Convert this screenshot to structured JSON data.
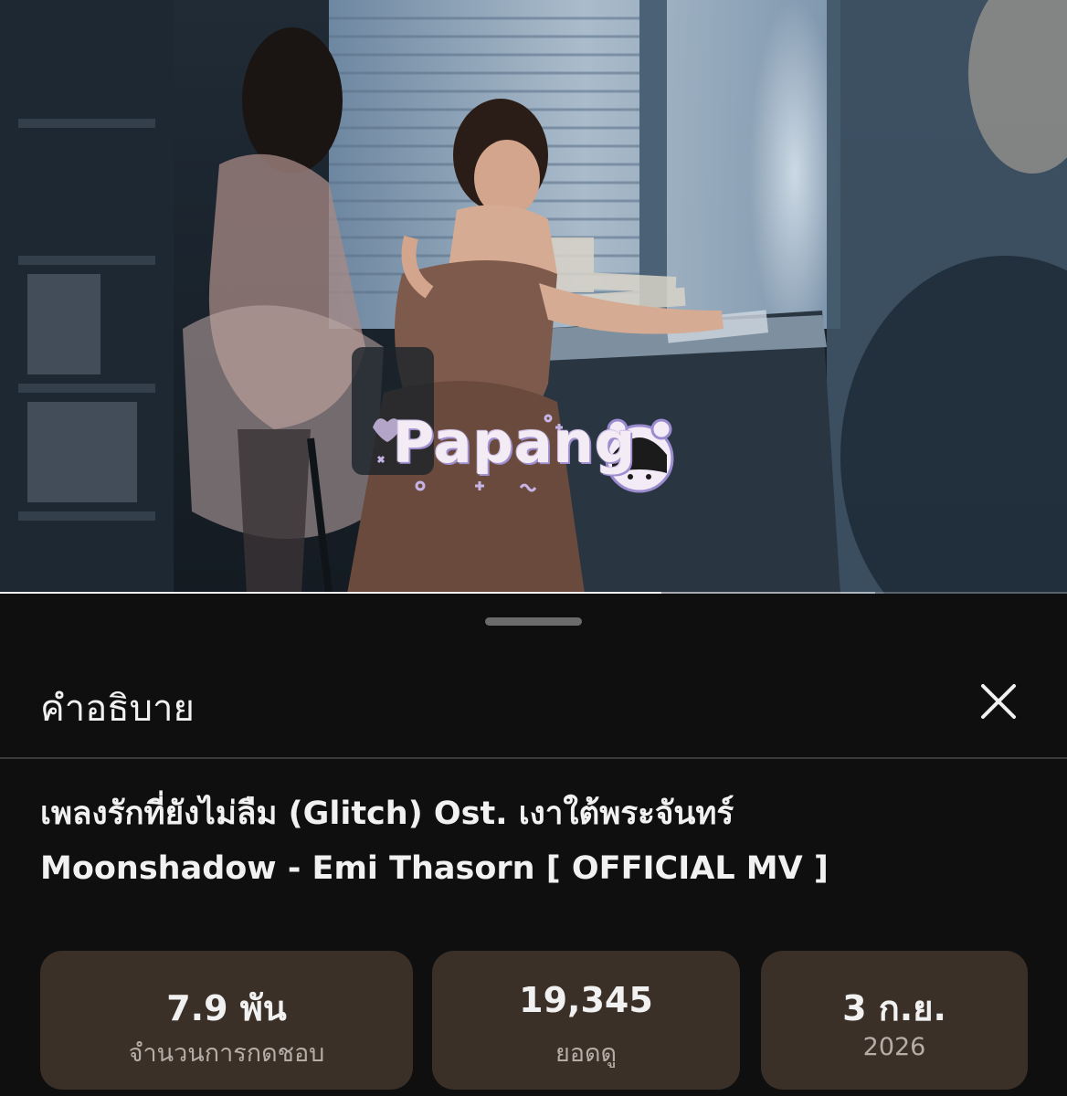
{
  "player": {
    "watermark_text": "Papang",
    "progress_fraction": 0.62,
    "buffered_fraction": 0.82
  },
  "description_sheet": {
    "header_title": "คำอธิบาย",
    "close_icon": "close-icon",
    "video_title_line1": "เพลงรักที่ยังไม่ลืม (Glitch) Ost. เงาใต้พระจันทร์",
    "video_title_line2": "Moonshadow - Emi Thasorn [ OFFICIAL MV ]",
    "stats": [
      {
        "value": "7.9 พัน",
        "label": "จำนวนการกดชอบ"
      },
      {
        "value": "19,345",
        "label": "ยอดดู"
      },
      {
        "value": "3 ก.ย.",
        "label": "2026"
      }
    ]
  },
  "colors": {
    "background": "#0f0f0f",
    "stat_card": "#3b3028",
    "text_primary": "#f1f1f1",
    "text_secondary": "#b5ada6",
    "divider": "#3a3a3a"
  }
}
